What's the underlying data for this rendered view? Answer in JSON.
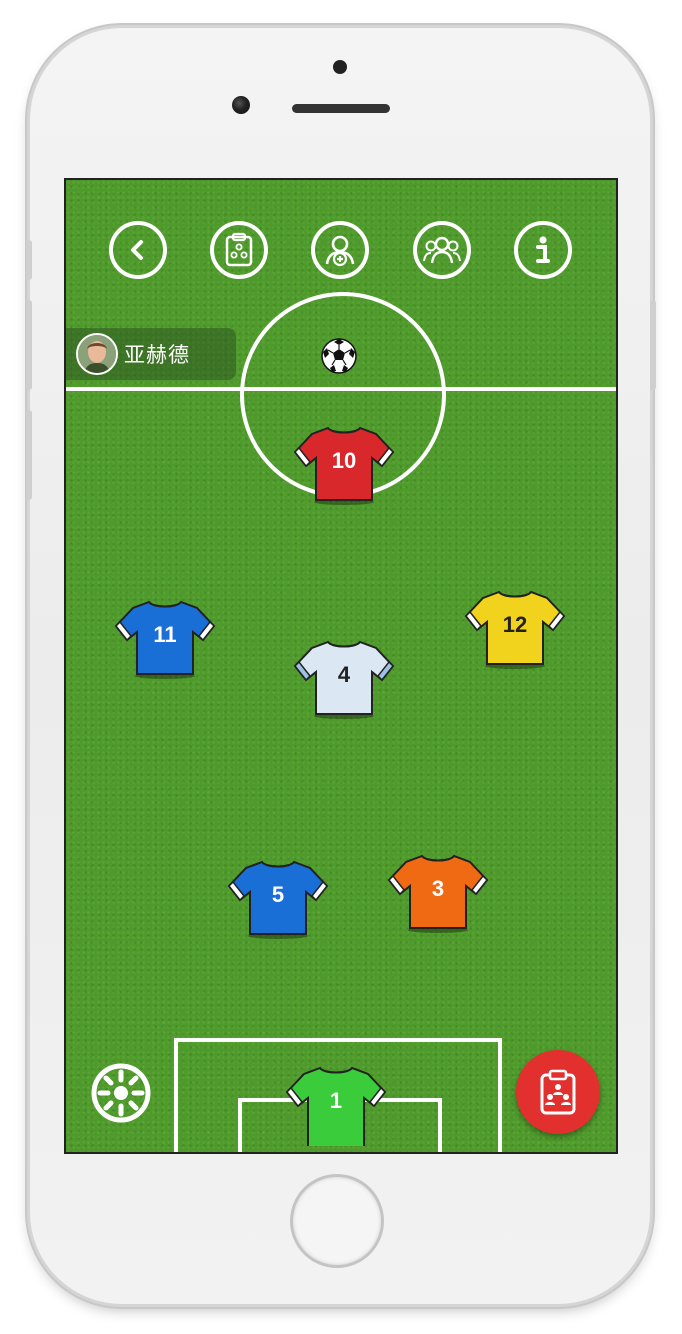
{
  "toolbar": {
    "icons": [
      "back-icon",
      "tactics-board-icon",
      "add-player-icon",
      "team-icon",
      "info-icon"
    ]
  },
  "badge": {
    "name": "亚赫德"
  },
  "players": [
    {
      "number": "10",
      "color": "#d8282c",
      "name": "jersey-10"
    },
    {
      "number": "11",
      "color": "#1a6fd6",
      "name": "jersey-11"
    },
    {
      "number": "12",
      "color": "#f1d21c",
      "name": "jersey-12"
    },
    {
      "number": "4",
      "color": "#dbe8f4",
      "name": "jersey-4"
    },
    {
      "number": "5",
      "color": "#1a6fd6",
      "name": "jersey-5"
    },
    {
      "number": "3",
      "color": "#f06a14",
      "name": "jersey-3"
    },
    {
      "number": "1",
      "color": "#3bcc3b",
      "name": "jersey-1"
    }
  ],
  "colors": {
    "pitch": "#4e9a2a",
    "fab": "#e2302e",
    "line": "#ffffff"
  }
}
